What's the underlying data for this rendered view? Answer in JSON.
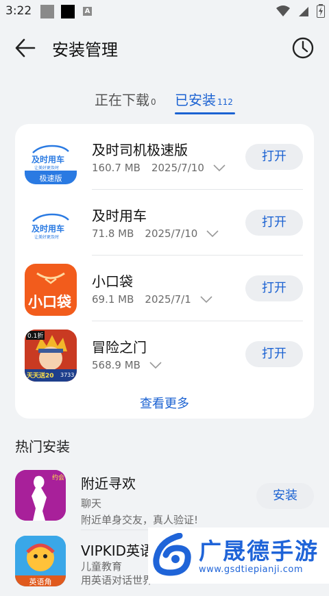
{
  "status_bar": {
    "time": "3:22",
    "a_badge": "A"
  },
  "header": {
    "title": "安装管理"
  },
  "tabs": [
    {
      "label": "正在下载",
      "count": "0"
    },
    {
      "label": "已安装",
      "count": "112"
    }
  ],
  "installed_apps": [
    {
      "name": "及时司机极速版",
      "size": "160.7 MB",
      "date": "2025/7/10",
      "action": "打开",
      "icon_text": "及时用车",
      "icon_sub": "让美好更及时",
      "icon_badge": "极速版"
    },
    {
      "name": "及时用车",
      "size": "71.8 MB",
      "date": "2025/7/10",
      "action": "打开",
      "icon_text": "及时用车",
      "icon_sub": "让美好更及时"
    },
    {
      "name": "小口袋",
      "size": "69.1 MB",
      "date": "2025/7/1",
      "action": "打开",
      "icon_text": "小口袋"
    },
    {
      "name": "冒险之门",
      "size": "568.9 MB",
      "date": "",
      "action": "打开",
      "icon_badge": "0.1折",
      "icon_bottom": "天天送20",
      "icon_bottom_num": "3733"
    }
  ],
  "more_label": "查看更多",
  "hot_section": {
    "title": "热门安装",
    "apps": [
      {
        "name": "附近寻欢",
        "category": "聊天",
        "desc": "附近单身交友，真人验证!",
        "action": "安装",
        "icon_badge": "约会"
      },
      {
        "name": "VIPKID英语",
        "category": "儿童教育",
        "desc": "用英语对话世界",
        "icon_bottom": "英语角"
      }
    ]
  },
  "watermark": {
    "title": "广晟德手游",
    "url": "www.gsdtiepianji.com"
  },
  "colors": {
    "accent": "#1b62d2",
    "background": "#f1f3f5",
    "card": "#ffffff"
  }
}
